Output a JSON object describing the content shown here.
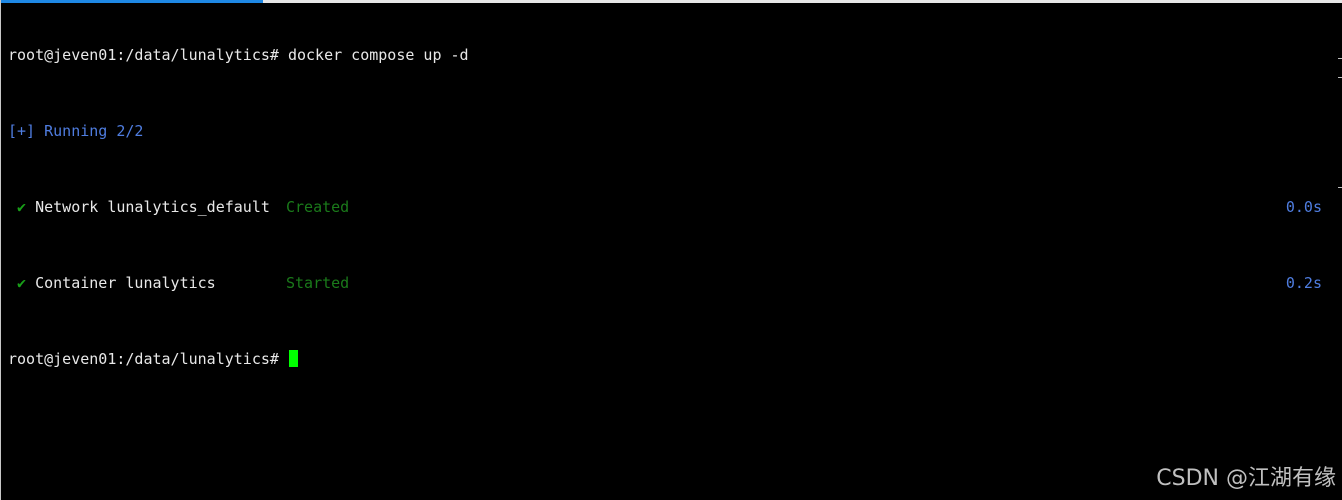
{
  "terminal": {
    "line1": {
      "prompt": "root@jeven01:/data/lunalytics#",
      "command": "docker compose up -d"
    },
    "line2": {
      "text": "[+] Running 2/2"
    },
    "resources": [
      {
        "check": "✔",
        "name": "Network lunalytics_default",
        "status": "Created",
        "duration": "0.0s"
      },
      {
        "check": "✔",
        "name": "Container lunalytics",
        "status": "Started",
        "duration": "0.2s"
      }
    ],
    "line5": {
      "prompt": "root@jeven01:/data/lunalytics#"
    }
  },
  "watermark": "CSDN @江湖有缘",
  "colors": {
    "background": "#000000",
    "foreground": "#e8e8e8",
    "blue": "#4f7de0",
    "green": "#18a018",
    "cursor": "#00ff00"
  }
}
